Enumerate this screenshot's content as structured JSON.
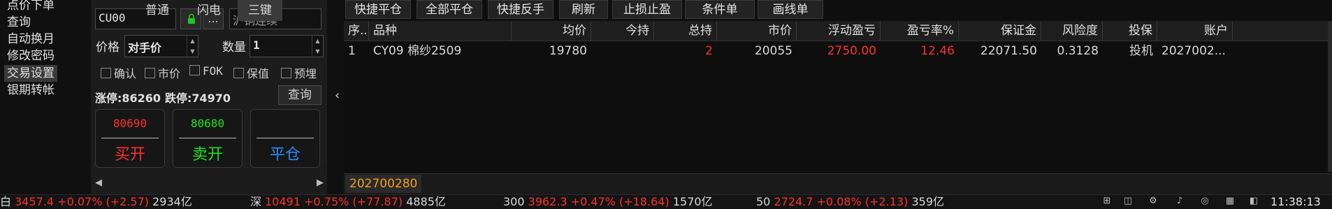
{
  "menu": {
    "items": [
      "点价下单",
      "查询",
      "自动换月",
      "修改密码",
      "交易设置",
      "银期转帐"
    ]
  },
  "order": {
    "contract_code": "CU00",
    "lock_icon": "lock-icon",
    "more_label": "...",
    "contract_name": "沪铜连续",
    "price_label": "价格",
    "price_type": "对手价",
    "qty_label": "数量",
    "qty_value": "1",
    "options": [
      "确认",
      "市价",
      "FOK",
      "保值",
      "预埋"
    ],
    "limit_up_label": "涨停:86260",
    "limit_down_label": "跌停:74970",
    "query_button": "查询",
    "buy_open": {
      "price": "80690",
      "label": "买开"
    },
    "sell_open": {
      "price": "80680",
      "label": "卖开"
    },
    "close": {
      "price": "",
      "label": "平仓"
    },
    "modes": [
      "普通",
      "闪电",
      "三键"
    ],
    "collapse_icon": "chevron-left-icon"
  },
  "toolbar": {
    "buttons": [
      "快捷平仓",
      "全部平仓",
      "快捷反手",
      "刷新",
      "止损止盈",
      "条件单",
      "画线单"
    ]
  },
  "positions": {
    "headers": [
      "序..",
      "品种",
      "均价",
      "今持",
      "总持",
      "市价",
      "浮动盈亏",
      "盈亏率%",
      "保证金",
      "风险度",
      "投保",
      "账户"
    ],
    "rows": [
      [
        "1",
        "CY09 棉纱2509",
        "19780",
        "",
        "2",
        "20055",
        "2750.00",
        "12.46",
        "22071.50",
        "0.3128",
        "投机",
        "2027002..."
      ]
    ]
  },
  "account_tab": "202700280",
  "status_bar": {
    "items": [
      {
        "prefix": "白",
        "value": "3457.4 +0.07% (+2.57)",
        "suffix": "2934亿"
      },
      {
        "prefix": "深",
        "value": "10491 +0.75% (+77.87)",
        "suffix": "4885亿"
      },
      {
        "prefix": "300",
        "value": "3962.3 +0.47% (+18.64)",
        "suffix": "1570亿"
      },
      {
        "prefix": "50",
        "value": "2724.7 +0.08% (+2.13)",
        "suffix": "359亿"
      }
    ],
    "time": "11:38:13"
  },
  "colors": {
    "up": "#ff3030",
    "down": "#20e020",
    "close": "#2a8cff",
    "account": "#f0a020"
  }
}
